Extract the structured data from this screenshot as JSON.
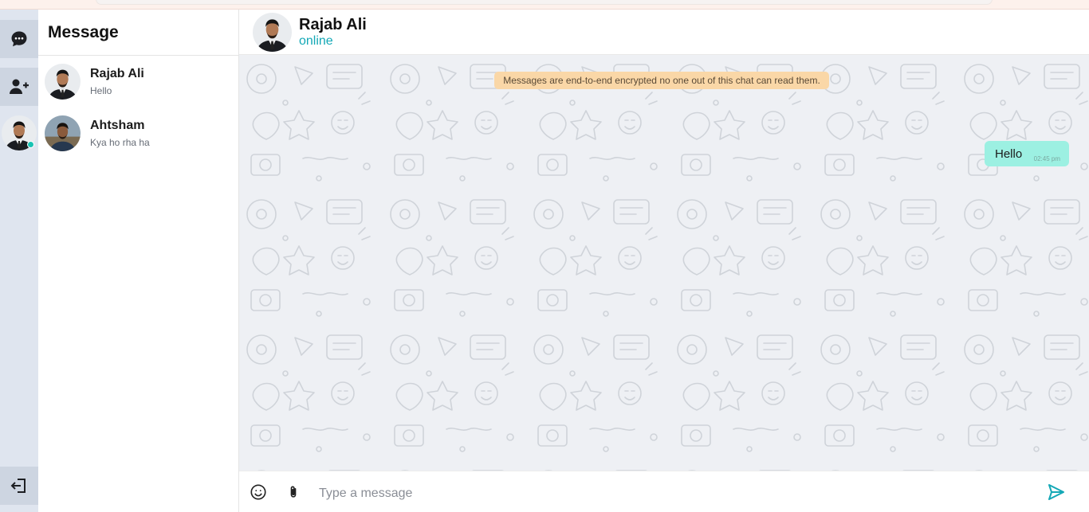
{
  "sidebar": {
    "items": [
      {
        "name": "chats",
        "icon": "chat-bubble-icon"
      },
      {
        "name": "add-contact",
        "icon": "add-user-icon"
      },
      {
        "name": "profile",
        "icon": "avatar"
      },
      {
        "name": "logout",
        "icon": "logout-icon"
      }
    ]
  },
  "contacts_panel": {
    "title": "Message",
    "contacts": [
      {
        "name": "Rajab Ali",
        "last_message": "Hello"
      },
      {
        "name": "Ahtsham",
        "last_message": "Kya ho rha ha"
      }
    ]
  },
  "chat": {
    "contact_name": "Rajab Ali",
    "status": "online",
    "encryption_notice": "Messages are end-to-end encrypted no one out of this chat can read them.",
    "messages": [
      {
        "text": "Hello",
        "time": "02:45 pm",
        "direction": "outgoing"
      }
    ]
  },
  "composer": {
    "placeholder": "Type a message",
    "emoji_icon": "emoji-icon",
    "attach_icon": "paperclip-icon",
    "send_icon": "send-icon"
  },
  "colors": {
    "accent": "#13a8b6",
    "outgoing_bubble": "#9cf0e2",
    "notice_bg": "#fad7a7",
    "rail_bg": "#dfe5ef",
    "chat_wallpaper": "#eef0f4"
  }
}
